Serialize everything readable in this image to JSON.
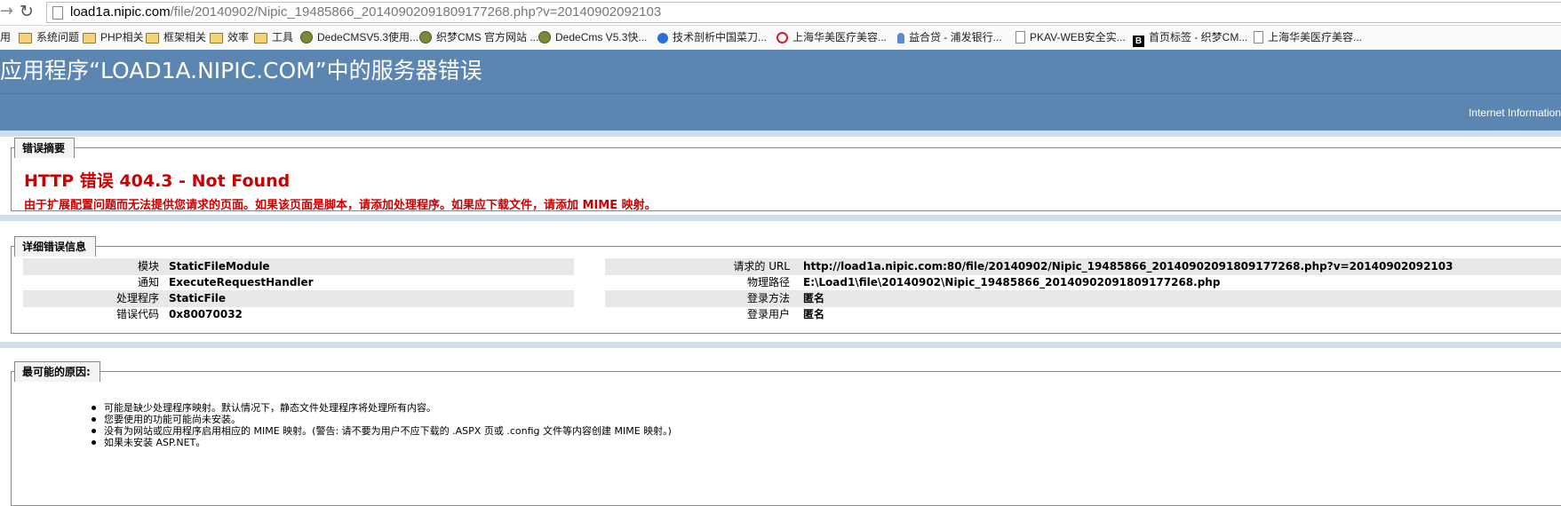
{
  "browser": {
    "back_icon": "back-arrow-icon",
    "reload_icon": "reload-icon",
    "url_host": "load1a.nipic.com",
    "url_path": "/file/20140902/Nipic_19485866_20140902091809177268.php?v=20140902092103"
  },
  "bookmarks": [
    {
      "label": "用",
      "icon": "none"
    },
    {
      "label": "系统问题",
      "icon": "folder-icon"
    },
    {
      "label": "PHP相关",
      "icon": "folder-icon"
    },
    {
      "label": "框架相关",
      "icon": "folder-icon"
    },
    {
      "label": "效率",
      "icon": "folder-icon"
    },
    {
      "label": "工具",
      "icon": "folder-icon"
    },
    {
      "label": "DedeCMSV5.3使用...",
      "icon": "dede-icon"
    },
    {
      "label": "织梦CMS 官方网站 ...",
      "icon": "dede-icon"
    },
    {
      "label": "DedeCms V5.3快...",
      "icon": "dede-icon"
    },
    {
      "label": "技术剖析中国菜刀...",
      "icon": "blue-icon"
    },
    {
      "label": "上海华美医疗美容...",
      "icon": "red-ring-icon"
    },
    {
      "label": "益合贷 - 浦发银行...",
      "icon": "person-icon"
    },
    {
      "label": "PKAV-WEB安全实...",
      "icon": "page-icon"
    },
    {
      "label": "首页标签 - 织梦CM...",
      "icon": "b-icon"
    },
    {
      "label": "上海华美医疗美容...",
      "icon": "page-icon"
    }
  ],
  "header": {
    "title": "应用程序“LOAD1A.NIPIC.COM”中的服务器错误",
    "subtitle": "Internet Information"
  },
  "summary": {
    "legend": "错误摘要",
    "error_title": "HTTP 错误 404.3 - Not Found",
    "error_desc": "由于扩展配置问题而无法提供您请求的页面。如果该页面是脚本，请添加处理程序。如果应下载文件，请添加 MIME 映射。"
  },
  "details": {
    "legend": "详细错误信息",
    "left": [
      {
        "key": "模块",
        "value": "StaticFileModule"
      },
      {
        "key": "通知",
        "value": "ExecuteRequestHandler"
      },
      {
        "key": "处理程序",
        "value": "StaticFile"
      },
      {
        "key": "错误代码",
        "value": "0x80070032"
      }
    ],
    "right": [
      {
        "key": "请求的 URL",
        "value": "http://load1a.nipic.com:80/file/20140902/Nipic_19485866_20140902091809177268.php?v=20140902092103"
      },
      {
        "key": "物理路径",
        "value": "E:\\Load1\\file\\20140902\\Nipic_19485866_20140902091809177268.php"
      },
      {
        "key": "登录方法",
        "value": "匿名"
      },
      {
        "key": "登录用户",
        "value": "匿名"
      }
    ]
  },
  "causes": {
    "legend": "最可能的原因:",
    "items": [
      "可能是缺少处理程序映射。默认情况下，静态文件处理程序将处理所有内容。",
      "您要使用的功能可能尚未安装。",
      "没有为网站或应用程序启用相应的 MIME 映射。(警告: 请不要为用户不应下载的 .ASPX 页或 .config 文件等内容创建 MIME 映射。)",
      "如果未安装 ASP.NET。"
    ]
  }
}
